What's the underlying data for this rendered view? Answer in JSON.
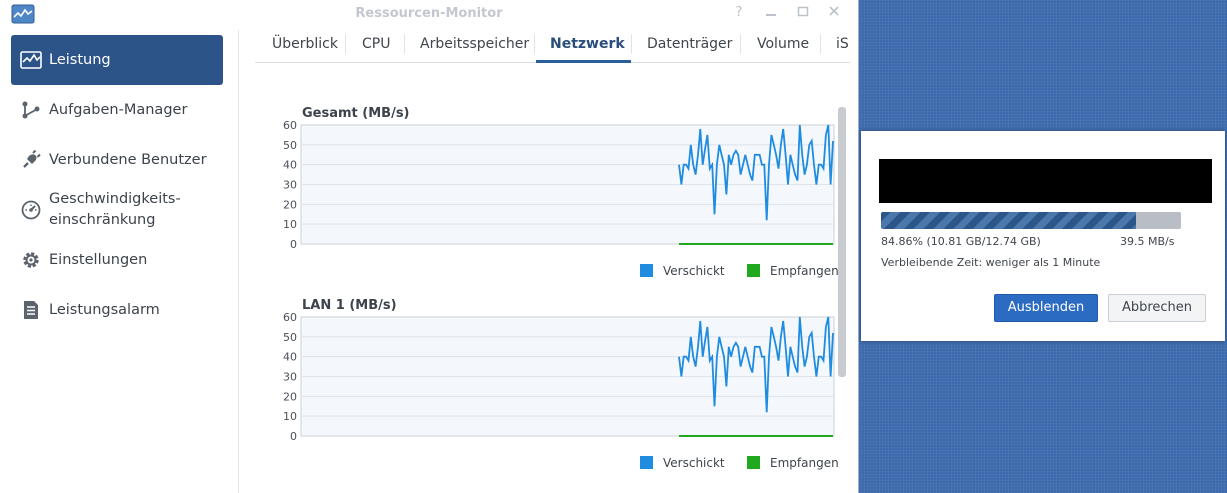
{
  "window": {
    "title": "Ressourcen-Monitor"
  },
  "sidebar": {
    "items": [
      {
        "label": "Leistung",
        "icon": "activity-chart-icon",
        "active": true
      },
      {
        "label": "Aufgaben-Manager",
        "icon": "task-graph-icon"
      },
      {
        "label": "Verbundene Benutzer",
        "icon": "plug-icon"
      },
      {
        "label": "Geschwindigkeits-",
        "label2": "einschränkung",
        "icon": "speedometer-icon"
      },
      {
        "label": "Einstellungen",
        "icon": "gear-icon"
      },
      {
        "label": "Leistungsalarm",
        "icon": "alarm-list-icon"
      }
    ]
  },
  "tabs": [
    "Überblick",
    "CPU",
    "Arbeitsspeicher",
    "Netzwerk",
    "Datenträger",
    "Volume",
    "iS"
  ],
  "active_tab": "Netzwerk",
  "charts": {
    "legend": {
      "sent": "Verschickt",
      "received": "Empfangen"
    },
    "colors": {
      "sent": "#1f8ce0",
      "received": "#20a81e"
    }
  },
  "chart_data": [
    {
      "type": "line",
      "title": "Gesamt (MB/s)",
      "ylim": [
        0,
        60
      ],
      "yticks": [
        0,
        10,
        20,
        30,
        40,
        50,
        60
      ],
      "series": [
        {
          "name": "Verschickt",
          "values": [
            40,
            30,
            40,
            40,
            38,
            50,
            40,
            35,
            45,
            58,
            40,
            48,
            55,
            38,
            40,
            15,
            40,
            50,
            45,
            40,
            25,
            45,
            40,
            45,
            47,
            45,
            35,
            40,
            45,
            40,
            35,
            32,
            45,
            45,
            45,
            40,
            40,
            12,
            40,
            55,
            50,
            45,
            38,
            50,
            58,
            45,
            30,
            45,
            40,
            35,
            32,
            60,
            45,
            35,
            40,
            50,
            52,
            40,
            30,
            40,
            40,
            38,
            55,
            60,
            30,
            52
          ]
        },
        {
          "name": "Empfangen",
          "values": [
            0,
            0,
            0,
            0,
            0,
            0,
            0,
            0,
            0,
            0,
            0,
            0,
            0,
            0,
            0,
            0,
            0,
            0,
            0,
            0,
            0,
            0,
            0,
            0,
            0,
            0,
            0,
            0,
            0,
            0,
            0,
            0,
            0,
            0,
            0,
            0,
            0,
            0,
            0,
            0,
            0,
            0,
            0,
            0,
            0,
            0,
            0,
            0,
            0,
            0,
            0,
            0,
            0,
            0,
            0,
            0,
            0,
            0,
            0,
            0,
            0,
            0,
            0,
            0,
            0,
            0
          ]
        }
      ]
    },
    {
      "type": "line",
      "title": "LAN 1 (MB/s)",
      "ylim": [
        0,
        60
      ],
      "yticks": [
        0,
        10,
        20,
        30,
        40,
        50,
        60
      ],
      "series": [
        {
          "name": "Verschickt",
          "values": [
            40,
            30,
            40,
            40,
            38,
            50,
            40,
            35,
            45,
            58,
            40,
            48,
            55,
            38,
            40,
            15,
            40,
            50,
            45,
            40,
            25,
            45,
            40,
            45,
            47,
            45,
            35,
            40,
            45,
            40,
            35,
            32,
            45,
            45,
            45,
            40,
            40,
            12,
            40,
            55,
            50,
            45,
            38,
            50,
            58,
            45,
            30,
            45,
            40,
            35,
            32,
            60,
            45,
            35,
            40,
            50,
            52,
            40,
            30,
            40,
            40,
            38,
            55,
            60,
            30,
            52
          ]
        },
        {
          "name": "Empfangen",
          "values": [
            0,
            0,
            0,
            0,
            0,
            0,
            0,
            0,
            0,
            0,
            0,
            0,
            0,
            0,
            0,
            0,
            0,
            0,
            0,
            0,
            0,
            0,
            0,
            0,
            0,
            0,
            0,
            0,
            0,
            0,
            0,
            0,
            0,
            0,
            0,
            0,
            0,
            0,
            0,
            0,
            0,
            0,
            0,
            0,
            0,
            0,
            0,
            0,
            0,
            0,
            0,
            0,
            0,
            0,
            0,
            0,
            0,
            0,
            0,
            0,
            0,
            0,
            0,
            0,
            0,
            0
          ]
        }
      ]
    }
  ],
  "dialog": {
    "progress": 0.8486,
    "progress_text": "84.86% (10.81 GB/12.74 GB)",
    "speed": "39.5 MB/s",
    "remaining": "Verbleibende Zeit: weniger als 1 Minute",
    "hide_label": "Ausblenden",
    "cancel_label": "Abbrechen"
  }
}
